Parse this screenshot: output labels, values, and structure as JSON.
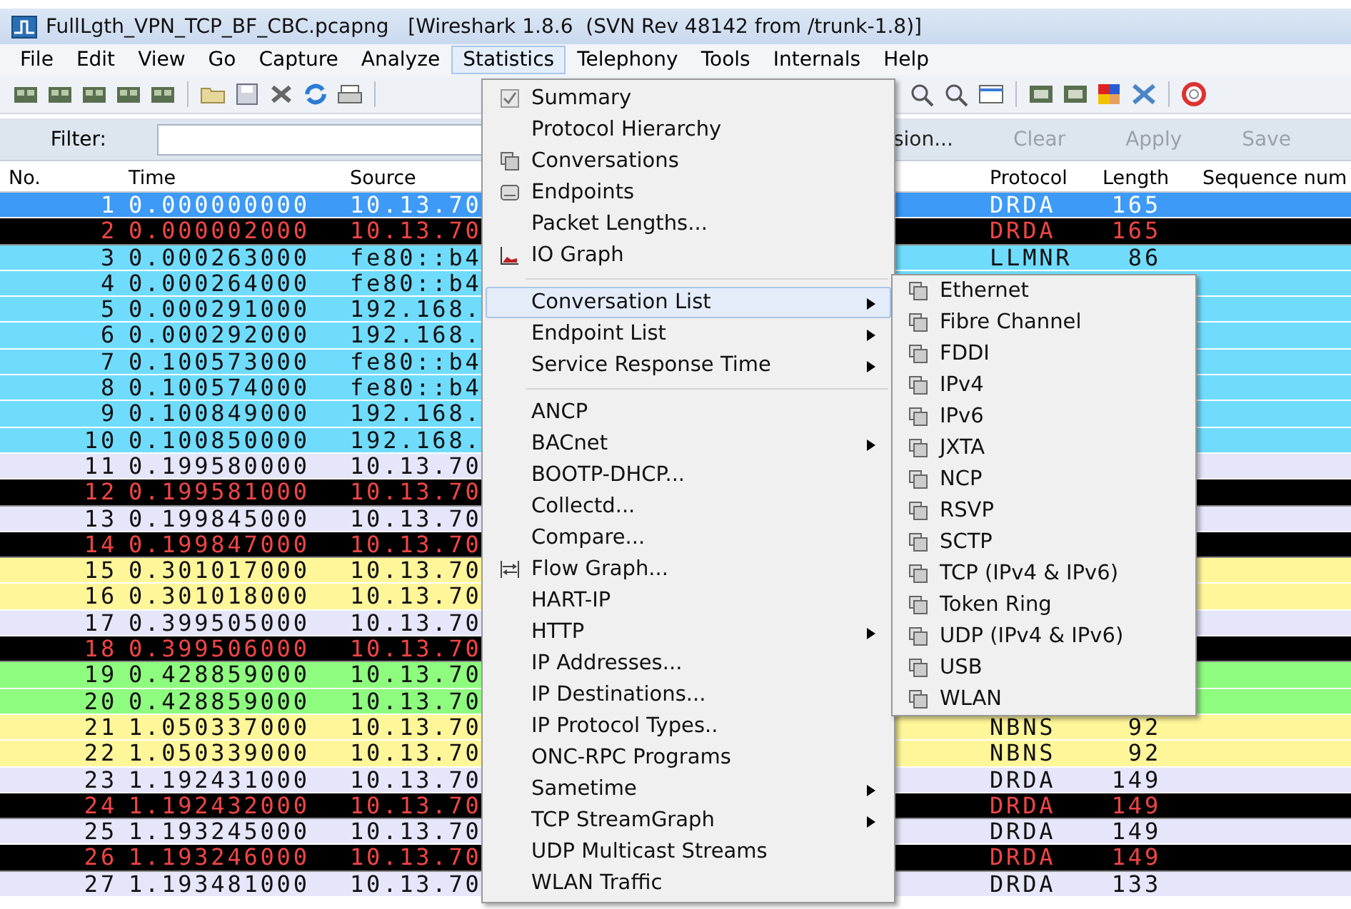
{
  "window": {
    "title": "FullLgth_VPN_TCP_BF_CBC.pcapng   [Wireshark 1.8.6  (SVN Rev 48142 from /trunk-1.8)]"
  },
  "menu_bar": [
    {
      "label": "File",
      "selected": false
    },
    {
      "label": "Edit",
      "selected": false
    },
    {
      "label": "View",
      "selected": false
    },
    {
      "label": "Go",
      "selected": false
    },
    {
      "label": "Capture",
      "selected": false
    },
    {
      "label": "Analyze",
      "selected": false
    },
    {
      "label": "Statistics",
      "selected": true
    },
    {
      "label": "Telephony",
      "selected": false
    },
    {
      "label": "Tools",
      "selected": false
    },
    {
      "label": "Internals",
      "selected": false
    },
    {
      "label": "Help",
      "selected": false
    }
  ],
  "filter_bar": {
    "label": "Filter:",
    "buttons": [
      {
        "label": "sion...",
        "disabled": false
      },
      {
        "label": "Clear",
        "disabled": true
      },
      {
        "label": "Apply",
        "disabled": true
      },
      {
        "label": "Save",
        "disabled": true
      }
    ]
  },
  "table": {
    "columns": [
      "No.",
      "Time",
      "Source",
      "Protocol",
      "Length",
      "Sequence num"
    ],
    "rows": [
      {
        "no": "1",
        "time": "0.000000000",
        "source": "10.13.70",
        "protocol": "DRDA",
        "length": "165",
        "selected": true
      },
      {
        "no": "2",
        "time": "0.000002000",
        "source": "10.13.70",
        "protocol": "DRDA",
        "length": "165",
        "kind": "black",
        "selected": false
      },
      {
        "no": "3",
        "time": "0.000263000",
        "source": "fe80::b4",
        "protocol": "LLMNR",
        "length": "86",
        "kind": "cyan",
        "selected": false
      },
      {
        "no": "4",
        "time": "0.000264000",
        "source": "fe80::b4",
        "kind": "cyan",
        "selected": false
      },
      {
        "no": "5",
        "time": "0.000291000",
        "source": "192.168.",
        "kind": "cyan",
        "selected": false
      },
      {
        "no": "6",
        "time": "0.000292000",
        "source": "192.168.",
        "kind": "cyan",
        "selected": false
      },
      {
        "no": "7",
        "time": "0.100573000",
        "source": "fe80::b4",
        "kind": "cyan",
        "selected": false
      },
      {
        "no": "8",
        "time": "0.100574000",
        "source": "fe80::b4",
        "kind": "cyan",
        "selected": false
      },
      {
        "no": "9",
        "time": "0.100849000",
        "source": "192.168.",
        "kind": "cyan",
        "selected": false
      },
      {
        "no": "10",
        "time": "0.100850000",
        "source": "192.168.",
        "kind": "cyan",
        "selected": false
      },
      {
        "no": "11",
        "time": "0.199580000",
        "source": "10.13.70",
        "kind": "lavender",
        "selected": false
      },
      {
        "no": "12",
        "time": "0.199581000",
        "source": "10.13.70",
        "kind": "black",
        "selected": false
      },
      {
        "no": "13",
        "time": "0.199845000",
        "source": "10.13.70",
        "kind": "lavender",
        "selected": false
      },
      {
        "no": "14",
        "time": "0.199847000",
        "source": "10.13.70",
        "kind": "black",
        "selected": false
      },
      {
        "no": "15",
        "time": "0.301017000",
        "source": "10.13.70",
        "kind": "yellow",
        "selected": false
      },
      {
        "no": "16",
        "time": "0.301018000",
        "source": "10.13.70",
        "kind": "yellow",
        "selected": false
      },
      {
        "no": "17",
        "time": "0.399505000",
        "source": "10.13.70",
        "kind": "lavender",
        "selected": false
      },
      {
        "no": "18",
        "time": "0.399506000",
        "source": "10.13.70",
        "kind": "black",
        "selected": false
      },
      {
        "no": "19",
        "time": "0.428859000",
        "source": "10.13.70",
        "kind": "green",
        "selected": false
      },
      {
        "no": "20",
        "time": "0.428859000",
        "source": "10.13.70",
        "kind": "green",
        "selected": false
      },
      {
        "no": "21",
        "time": "1.050337000",
        "source": "10.13.70",
        "protocol": "NBNS",
        "length": "92",
        "kind": "yellow",
        "selected": false
      },
      {
        "no": "22",
        "time": "1.050339000",
        "source": "10.13.70",
        "protocol": "NBNS",
        "length": "92",
        "kind": "yellow",
        "selected": false
      },
      {
        "no": "23",
        "time": "1.192431000",
        "source": "10.13.70",
        "protocol": "DRDA",
        "length": "149",
        "kind": "lavender",
        "selected": false
      },
      {
        "no": "24",
        "time": "1.192432000",
        "source": "10.13.70",
        "protocol": "DRDA",
        "length": "149",
        "kind": "black",
        "selected": false
      },
      {
        "no": "25",
        "time": "1.193245000",
        "source": "10.13.70",
        "protocol": "DRDA",
        "length": "149",
        "kind": "lavender",
        "selected": false
      },
      {
        "no": "26",
        "time": "1.193246000",
        "source": "10.13.70",
        "protocol": "DRDA",
        "length": "149",
        "kind": "black",
        "selected": false
      },
      {
        "no": "27",
        "time": "1.193481000",
        "source": "10.13.70",
        "protocol": "DRDA",
        "length": "133",
        "kind": "lavender",
        "selected": false
      }
    ]
  },
  "statistics_menu": [
    {
      "kind": "item",
      "label": "Summary",
      "submenu": false,
      "selected": false
    },
    {
      "kind": "item",
      "label": "Protocol Hierarchy",
      "submenu": false,
      "selected": false
    },
    {
      "kind": "item",
      "label": "Conversations",
      "submenu": false,
      "selected": false
    },
    {
      "kind": "item",
      "label": "Endpoints",
      "submenu": false,
      "selected": false
    },
    {
      "kind": "item",
      "label": "Packet Lengths...",
      "submenu": false,
      "selected": false
    },
    {
      "kind": "item",
      "label": "IO Graph",
      "submenu": false,
      "selected": false
    },
    {
      "kind": "separator"
    },
    {
      "kind": "item",
      "label": "Conversation List",
      "submenu": true,
      "selected": true
    },
    {
      "kind": "item",
      "label": "Endpoint List",
      "submenu": true,
      "selected": false
    },
    {
      "kind": "item",
      "label": "Service Response Time",
      "submenu": true,
      "selected": false
    },
    {
      "kind": "separator"
    },
    {
      "kind": "item",
      "label": "ANCP",
      "submenu": false,
      "selected": false
    },
    {
      "kind": "item",
      "label": "BACnet",
      "submenu": true,
      "selected": false
    },
    {
      "kind": "item",
      "label": "BOOTP-DHCP...",
      "submenu": false,
      "selected": false
    },
    {
      "kind": "item",
      "label": "Collectd...",
      "submenu": false,
      "selected": false
    },
    {
      "kind": "item",
      "label": "Compare...",
      "submenu": false,
      "selected": false
    },
    {
      "kind": "item",
      "label": "Flow Graph...",
      "submenu": false,
      "selected": false
    },
    {
      "kind": "item",
      "label": "HART-IP",
      "submenu": false,
      "selected": false
    },
    {
      "kind": "item",
      "label": "HTTP",
      "submenu": true,
      "selected": false
    },
    {
      "kind": "item",
      "label": "IP Addresses...",
      "submenu": false,
      "selected": false
    },
    {
      "kind": "item",
      "label": "IP Destinations...",
      "submenu": false,
      "selected": false
    },
    {
      "kind": "item",
      "label": "IP Protocol Types..",
      "submenu": false,
      "selected": false
    },
    {
      "kind": "item",
      "label": "ONC-RPC Programs",
      "submenu": false,
      "selected": false
    },
    {
      "kind": "item",
      "label": "Sametime",
      "submenu": true,
      "selected": false
    },
    {
      "kind": "item",
      "label": "TCP StreamGraph",
      "submenu": true,
      "selected": false
    },
    {
      "kind": "item",
      "label": "UDP Multicast Streams",
      "submenu": false,
      "selected": false
    },
    {
      "kind": "item",
      "label": "WLAN Traffic",
      "submenu": false,
      "selected": false
    }
  ],
  "conversation_list_submenu": [
    {
      "label": "Ethernet"
    },
    {
      "label": "Fibre Channel"
    },
    {
      "label": "FDDI"
    },
    {
      "label": "IPv4"
    },
    {
      "label": "IPv6"
    },
    {
      "label": "JXTA"
    },
    {
      "label": "NCP"
    },
    {
      "label": "RSVP"
    },
    {
      "label": "SCTP"
    },
    {
      "label": "TCP (IPv4 & IPv6)"
    },
    {
      "label": "Token Ring"
    },
    {
      "label": "UDP (IPv4 & IPv6)"
    },
    {
      "label": "USB"
    },
    {
      "label": "WLAN"
    }
  ]
}
